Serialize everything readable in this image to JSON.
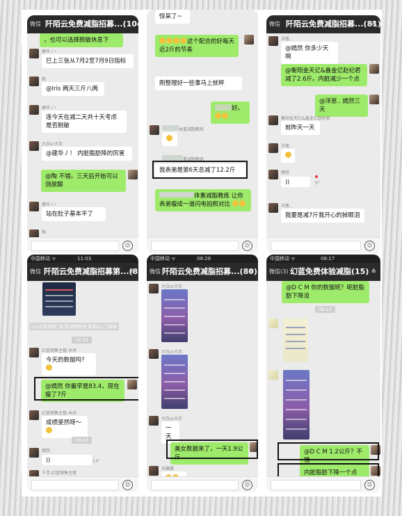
{
  "panel1": {
    "back": "微信",
    "title": "阡陌云免费减脂招募...(104)",
    "more": "≗",
    "partial_top": "，也可以选择脱敏休息下",
    "msgs": [
      {
        "sender": "建华丿!",
        "text": "巳上三张从7月2至7月9日指标"
      },
      {
        "sender": "陶",
        "text": "@Iris 两天三斤八两"
      },
      {
        "sender": "建华丿!",
        "text": "连今天在减二天共十天考虑是否脱敏"
      },
      {
        "sender": "大白or大灰",
        "text": "@建华丿！ 内脏脂肪降的厉害"
      },
      {
        "sender": "",
        "text": "@陶 不错。三天后开始可以测尿酮"
      },
      {
        "sender": "建华丿!",
        "text": "站在肚子基本平了"
      },
      {
        "sender": "陶",
        "text": ""
      }
    ]
  },
  "panel2": {
    "partial_top": "惊呆了~",
    "msgs": [
      {
        "text": "这个配合的好每天近2斤的节奏"
      },
      {
        "text": "刚整理好一些事马上就秤"
      },
      {
        "text": "好。"
      },
      {
        "sender": "体重减脂教练",
        "text": ""
      },
      {
        "sender": "重减脂教练",
        "text": "我表弟是第6天总减了12.2斤"
      },
      {
        "text": "体重减脂教练 让你表弟瘦成一道闪电拍照对比"
      }
    ]
  },
  "panel3": {
    "back": "微信",
    "title": "阡陌云免费减脂招募...(81)",
    "more": "≗",
    "msgs": [
      {
        "sender": "洋葱..",
        "text": "@嫣然 你多少天啊"
      },
      {
        "text": "@衡阳金天亿&鑫金亿赵纪君 减了2.6斤。内脏减少一个点"
      },
      {
        "text": "@洋葱.. 嫣然三天"
      },
      {
        "sender": "衡阳金天亿&鑫金亿赵纪君",
        "text": "就昨天一天"
      },
      {
        "sender": "洋葱..",
        "text": ""
      },
      {
        "sender": "嫣然",
        "text": "))",
        "duration": "5\""
      },
      {
        "sender": "洋葱..",
        "text": "我要是减7斤我开心的掉眼泪"
      }
    ]
  },
  "panel4": {
    "status": {
      "carrier": "中国移动 ᯤ",
      "time": "11:03"
    },
    "back": "微信",
    "title": "阡陌云免费减脂招募第...(81)",
    "more": "≗",
    "system": "iris-幻蓝清西门吃货|减堂粉亮 邀请加入了群聊",
    "time1": "09:33",
    "msgs": [
      {
        "sender": "幻蓝销售主管-木木",
        "text": "今天的数据吗？"
      },
      {
        "text": "@嫣然 你最早是83.4，现在瘦了7斤"
      },
      {
        "sender": "幻蓝销售主管-木木",
        "text": "成绩斐然呀～"
      },
      {
        "sender": "嫣然",
        "text": "))",
        "duration": "13\""
      },
      {
        "sender": "千寻-幻蓝销售主管",
        "text": ""
      }
    ],
    "time2": "09:43"
  },
  "panel5": {
    "status": {
      "carrier": "中国移动 ᯤ",
      "time": "08:26"
    },
    "back": "微信",
    "title": "阡陌云免费减脂招募...(80)",
    "more": "≗",
    "msgs": [
      {
        "sender": "大白or大灰",
        "text": ""
      },
      {
        "sender": "大白or大灰",
        "text": ""
      },
      {
        "sender": "大白or大灰",
        "text": "一天"
      },
      {
        "text": "美女数据来了，一天1.9公斤"
      },
      {
        "sender": "天赛赛",
        "text": ""
      }
    ]
  },
  "panel6": {
    "status": {
      "carrier": "中国移动 ᯤ",
      "time": "08:17"
    },
    "back": "微信(3)",
    "title": "幻蓝免费体验减脂(15)",
    "more": "≗",
    "msgs": [
      {
        "text": "@D C M 你的数据呢？呢脏脂肪下降没"
      },
      {
        "text": "@D C M 1.2公斤？不错"
      },
      {
        "text": "内脏脂肪下降一个点"
      }
    ],
    "time1": "08:15"
  },
  "emoji_icon": "smiley-icon",
  "colors": {
    "header": "#2a2a2a",
    "chat_bg": "#ebebeb",
    "bubble_green": "#9eea6a",
    "highlight_border": "#111111"
  }
}
